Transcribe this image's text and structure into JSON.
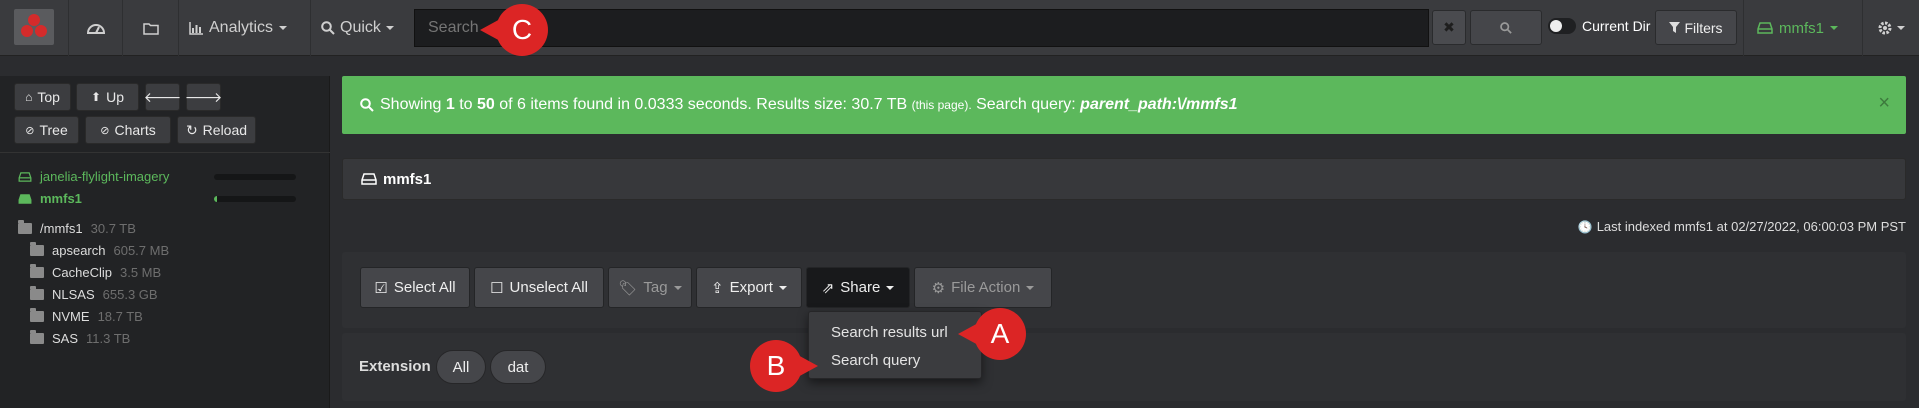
{
  "topbar": {
    "analytics_label": "Analytics",
    "quick_label": "Quick",
    "search_placeholder": "Search",
    "current_dir_label": "Current Dir",
    "filters_label": "Filters",
    "user_label": "mmfs1"
  },
  "sidebar": {
    "buttons": {
      "top": "Top",
      "up": "Up",
      "tree": "Tree",
      "charts": "Charts",
      "reload": "Reload"
    },
    "indexes": [
      {
        "name": "janelia-flylight-imagery",
        "usage": 0.0
      },
      {
        "name": "mmfs1",
        "usage": 0.04
      }
    ],
    "root": {
      "name": "/mmfs1",
      "size": "30.7 TB"
    },
    "folders": [
      {
        "name": "apsearch",
        "size": "605.7 MB"
      },
      {
        "name": "CacheClip",
        "size": "3.5 MB"
      },
      {
        "name": "NLSAS",
        "size": "655.3 GB"
      },
      {
        "name": "NVME",
        "size": "18.7 TB"
      },
      {
        "name": "SAS",
        "size": "11.3 TB"
      }
    ]
  },
  "alert": {
    "prefix": "Showing",
    "start": "1",
    "to": "to",
    "end": "50",
    "middle": "of 6 items found in 0.0333 seconds. Results size: 30.7 TB",
    "this_page": "(this page).",
    "query_label": "Search query:",
    "query": "parent_path:\\/mmfs1",
    "close": "×"
  },
  "panel": {
    "title": "mmfs1"
  },
  "last_indexed": "Last indexed mmfs1 at 02/27/2022, 06:00:03 PM PST",
  "actions": {
    "select_all": "Select All",
    "unselect_all": "Unselect All",
    "tag": "Tag",
    "export": "Export",
    "share": "Share",
    "file_action": "File Action"
  },
  "share_menu": [
    "Search results url",
    "Search query"
  ],
  "extension": {
    "label": "Extension",
    "pills": [
      "All",
      "dat"
    ]
  },
  "callouts": {
    "a": "A",
    "b": "B",
    "c": "C"
  },
  "colors": {
    "accent_green": "#5cb85c",
    "callout_red": "#dc2525"
  }
}
